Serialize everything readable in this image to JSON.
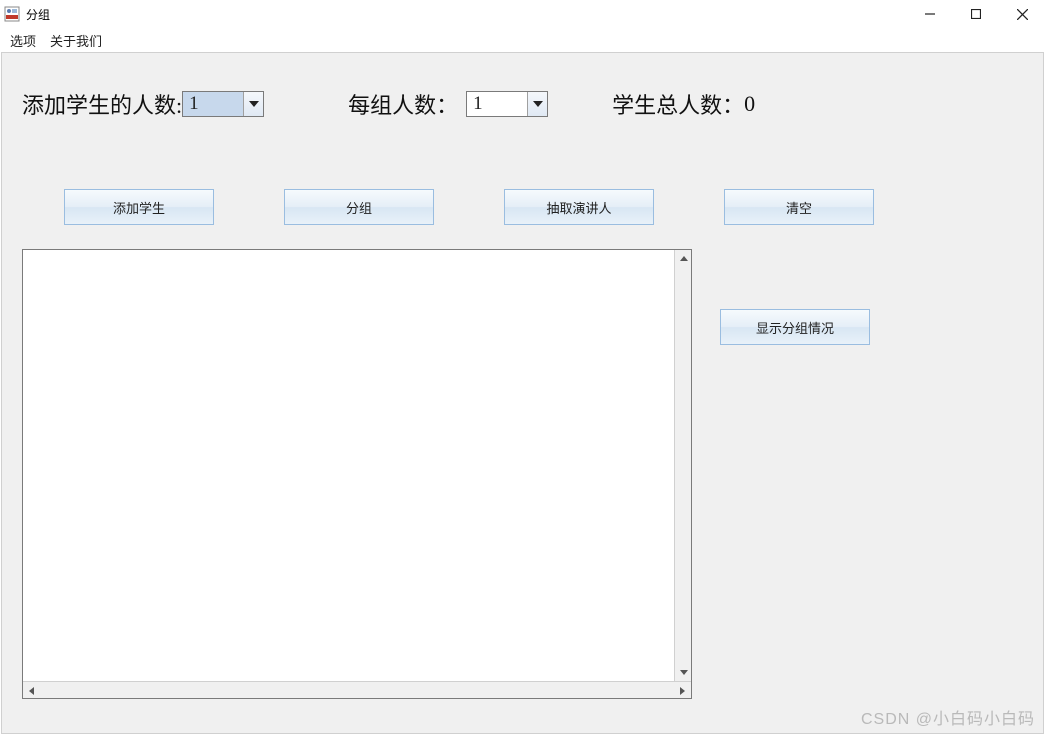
{
  "window": {
    "title": "分组"
  },
  "menubar": {
    "options": "选项",
    "about": "关于我们"
  },
  "row1": {
    "add_label": "添加学生的人数:",
    "add_value": "1",
    "per_group_label": "每组人数：",
    "per_group_value": "1",
    "total_label": "学生总人数：",
    "total_value": "0"
  },
  "buttons": {
    "add_student": "添加学生",
    "group": "分组",
    "pick_speaker": "抽取演讲人",
    "clear": "清空",
    "show_grouping": "显示分组情况"
  },
  "textarea": {
    "content": ""
  },
  "watermark": "CSDN @小白码小白码"
}
